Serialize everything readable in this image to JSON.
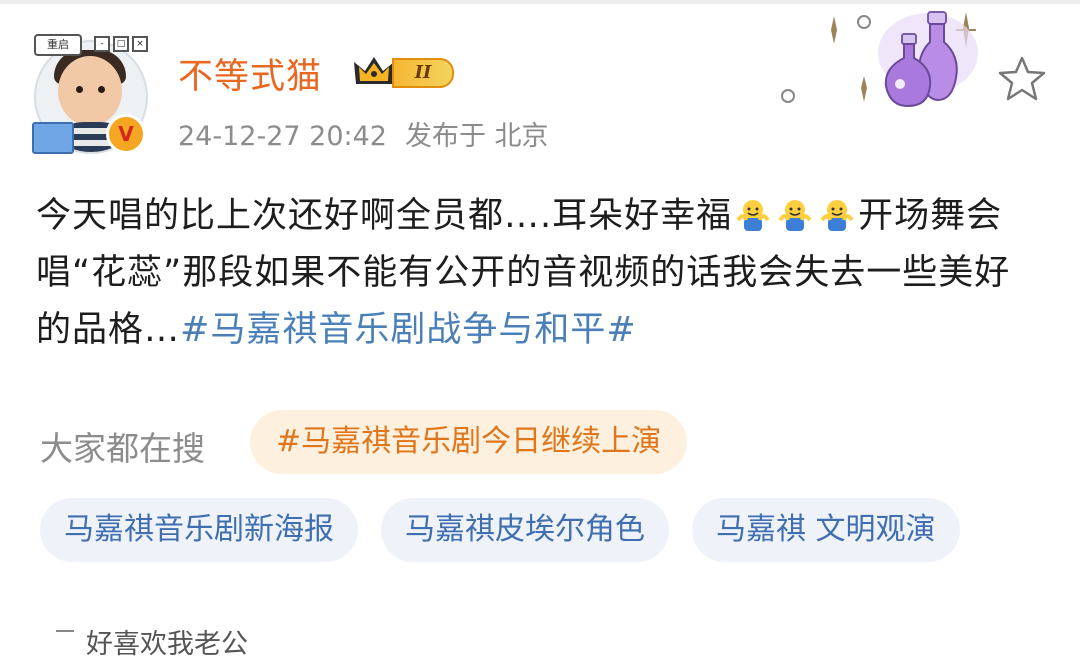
{
  "header": {
    "username": "不等式猫",
    "level_label": "II",
    "timestamp": "24-12-27 20:42",
    "source": "发布于 北京",
    "avatar_badge_text": "重启",
    "vip_badge": "V"
  },
  "post": {
    "text_part1": "今天唱的比上次还好啊全员都….耳朵好幸福",
    "text_part2": "开场舞会唱“花蕊”那段如果不能有公开的音视频的话我会失去一些美好的品格…",
    "topic": "#马嘉祺音乐剧战争与和平#",
    "emoji_count": 3
  },
  "search": {
    "label": "大家都在搜",
    "hot_chip": "#马嘉祺音乐剧今日继续上演",
    "chips": [
      "马嘉祺音乐剧新海报",
      "马嘉祺皮埃尔角色",
      "马嘉祺 文明观演"
    ]
  },
  "next_preview": "好喜欢我老公",
  "colors": {
    "username": "#e86722",
    "link": "#4a7fb8",
    "hot_chip_text": "#e0761a",
    "chip_text": "#3f6fb0"
  }
}
